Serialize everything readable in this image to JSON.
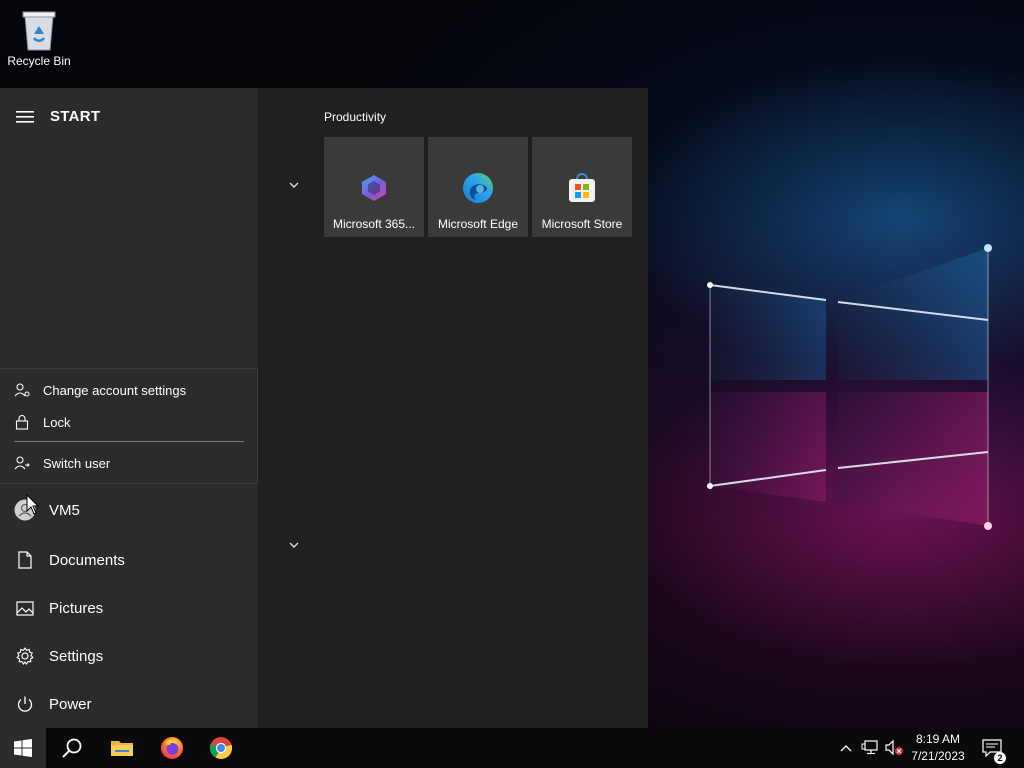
{
  "desktop": {
    "icons": [
      {
        "label": "Recycle Bin",
        "icon": "recycle-bin-icon"
      }
    ]
  },
  "start_menu": {
    "title": "START",
    "account_menu": {
      "items": [
        {
          "label": "Change account settings",
          "icon": "account-settings-icon"
        },
        {
          "label": "Lock",
          "icon": "lock-icon"
        },
        {
          "label": "Switch user",
          "icon": "switch-user-icon"
        }
      ]
    },
    "nav": [
      {
        "label": "VM5",
        "icon": "user-avatar-icon"
      },
      {
        "label": "Documents",
        "icon": "document-icon"
      },
      {
        "label": "Pictures",
        "icon": "pictures-icon"
      },
      {
        "label": "Settings",
        "icon": "gear-icon"
      },
      {
        "label": "Power",
        "icon": "power-icon"
      }
    ],
    "group": {
      "label": "Productivity",
      "tiles": [
        {
          "label": "Microsoft 365...",
          "icon": "microsoft-365-icon"
        },
        {
          "label": "Microsoft Edge",
          "icon": "edge-icon"
        },
        {
          "label": "Microsoft Store",
          "icon": "store-icon"
        }
      ]
    }
  },
  "taskbar": {
    "apps": [
      {
        "name": "Start",
        "icon": "windows-start-icon"
      },
      {
        "name": "Search",
        "icon": "search-icon"
      },
      {
        "name": "File Explorer",
        "icon": "folder-icon"
      },
      {
        "name": "Firefox",
        "icon": "firefox-icon"
      },
      {
        "name": "Chrome",
        "icon": "chrome-icon"
      }
    ],
    "tray": {
      "time": "8:19 AM",
      "date": "7/21/2023",
      "notification_count": "2"
    }
  },
  "colors": {
    "start_left_bg": "#2b2b2b",
    "start_right_bg": "#202020",
    "tile_bg": "#3a3a3a",
    "taskbar_bg": "#0a0a0a"
  }
}
